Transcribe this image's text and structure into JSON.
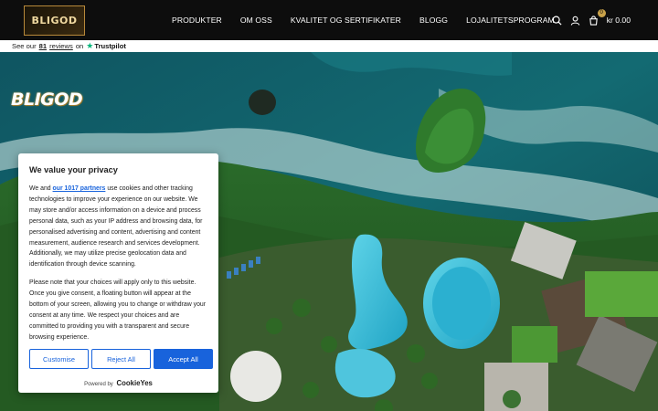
{
  "header": {
    "logo_text": "BLIGOD",
    "nav": [
      "PRODUKTER",
      "OM OSS",
      "KVALITET OG SERTIFIKATER",
      "BLOGG",
      "LOJALITETSPROGRAM"
    ],
    "icons": [
      "search-icon",
      "user-icon",
      "cart-icon"
    ],
    "cart_count": "0",
    "cart_total": "kr 0.00"
  },
  "trustpilot": {
    "prefix": "See our",
    "count": "81",
    "reviews": "reviews",
    "on": "on",
    "brand": "Trustpilot"
  },
  "hero": {
    "logo_text": "BLIGOD"
  },
  "cookie": {
    "title": "We value your privacy",
    "p1_start": "We and",
    "partners_link": "our 1017 partners",
    "p1_end": "use cookies and other tracking technologies to improve your experience on our website. We may store and/or access information on a device and process personal data, such as your IP address and browsing data, for personalised advertising and content, advertising and content measurement, audience research and services development. Additionally, we may utilize precise geolocation data and identification through device scanning.",
    "p2": "Please note that your choices will apply only to this website. Once you give consent, a floating button will appear at the bottom of your screen, allowing you to change or withdraw your consent at any time. We respect your choices and are committed to providing you with a transparent and secure browsing experience.",
    "customise": "Customise",
    "reject": "Reject All",
    "accept": "Accept All",
    "powered_by": "Powered by",
    "powered_brand": "CookieYes",
    "accent_color": "#1863dc"
  }
}
